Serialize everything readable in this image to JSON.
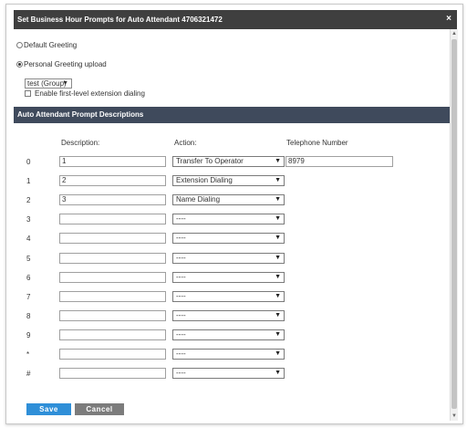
{
  "dialog": {
    "title": "Set Business Hour Prompts for Auto Attendant 4706321472",
    "close_icon": "close-icon"
  },
  "greeting": {
    "default_label": "Default Greeting",
    "default_checked": false,
    "personal_label": "Personal Greeting upload",
    "personal_checked": true
  },
  "group_select": {
    "value": "test (Group)"
  },
  "extension_dialing": {
    "label": "Enable first-level extension dialing",
    "checked": false
  },
  "prompt_section": {
    "header": "Auto Attendant Prompt Descriptions",
    "columns": {
      "description": "Description:",
      "action": "Action:",
      "telephone": "Telephone Number"
    },
    "rows": [
      {
        "key": "0",
        "description": "1",
        "action": "Transfer To Operator",
        "telephone": "8979"
      },
      {
        "key": "1",
        "description": "2",
        "action": "Extension Dialing",
        "telephone": ""
      },
      {
        "key": "2",
        "description": "3",
        "action": "Name Dialing",
        "telephone": ""
      },
      {
        "key": "3",
        "description": "",
        "action": "----",
        "telephone": ""
      },
      {
        "key": "4",
        "description": "",
        "action": "----",
        "telephone": ""
      },
      {
        "key": "5",
        "description": "",
        "action": "----",
        "telephone": ""
      },
      {
        "key": "6",
        "description": "",
        "action": "----",
        "telephone": ""
      },
      {
        "key": "7",
        "description": "",
        "action": "----",
        "telephone": ""
      },
      {
        "key": "8",
        "description": "",
        "action": "----",
        "telephone": ""
      },
      {
        "key": "9",
        "description": "",
        "action": "----",
        "telephone": ""
      },
      {
        "key": "*",
        "description": "",
        "action": "----",
        "telephone": ""
      },
      {
        "key": "#",
        "description": "",
        "action": "----",
        "telephone": ""
      }
    ]
  },
  "buttons": {
    "save": "Save",
    "cancel": "Cancel"
  },
  "colors": {
    "titlebar": "#3f3f3f",
    "section_header": "#3f4a5c",
    "save_button": "#2f8fd8",
    "cancel_button": "#7c7c7c"
  }
}
